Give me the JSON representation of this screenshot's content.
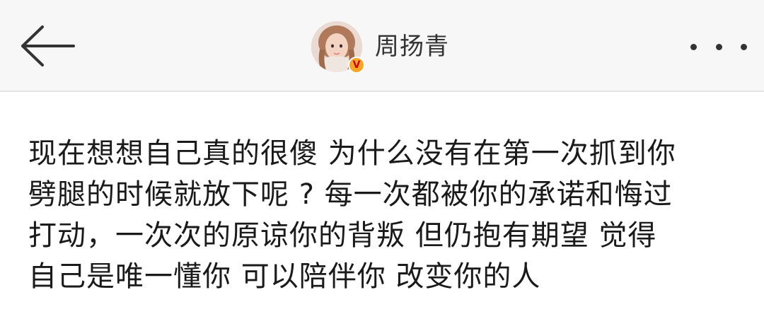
{
  "header": {
    "back_icon": "arrow-left-icon",
    "username": "周扬青",
    "verified_badge": "V",
    "more_icon": "more-dots-icon"
  },
  "post": {
    "lines": [
      "现在想想自己真的很傻 为什么没有在第一次抓到你",
      "劈腿的时候就放下呢 ? 每一次都被你的承诺和悔过",
      "打动，一次次的原谅你的背叛 但仍抱有期望 觉得",
      "自己是唯一懂你 可以陪伴你 改变你的人"
    ]
  },
  "colors": {
    "header_bg": "#f7f7f7",
    "text": "#1a1a1a",
    "verified": "#f5a623"
  }
}
